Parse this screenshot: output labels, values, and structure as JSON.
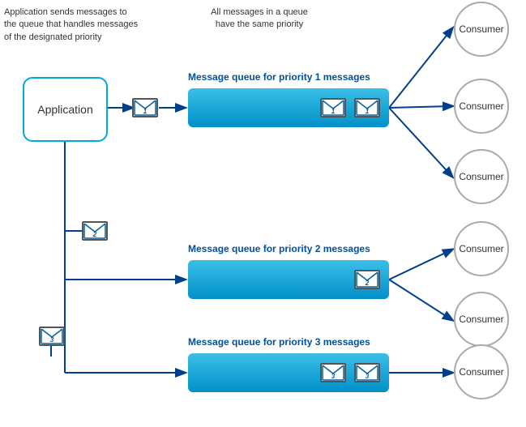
{
  "annotation1": {
    "line1": "Application sends messages to",
    "line2": "the queue that handles messages",
    "line3": "of the designated priority"
  },
  "annotation2": {
    "line1": "All messages in a queue",
    "line2": "have the same priority"
  },
  "app": {
    "label": "Application"
  },
  "queues": [
    {
      "id": "q1",
      "label": "Message queue for priority 1 messages",
      "priority": "1",
      "icons": 2
    },
    {
      "id": "q2",
      "label": "Message queue for priority 2 messages",
      "priority": "2",
      "icons": 1
    },
    {
      "id": "q3",
      "label": "Message queue for priority 3 messages",
      "priority": "3",
      "icons": 2
    }
  ],
  "consumers": [
    {
      "id": "c1",
      "label": "Consumer"
    },
    {
      "id": "c2",
      "label": "Consumer"
    },
    {
      "id": "c3",
      "label": "Consumer"
    },
    {
      "id": "c4",
      "label": "Consumer"
    },
    {
      "id": "c5",
      "label": "Consumer"
    },
    {
      "id": "c6",
      "label": "Consumer"
    }
  ],
  "colors": {
    "queue": "#29b5e8",
    "arrow": "#003f8a",
    "border": "#00aadd"
  }
}
